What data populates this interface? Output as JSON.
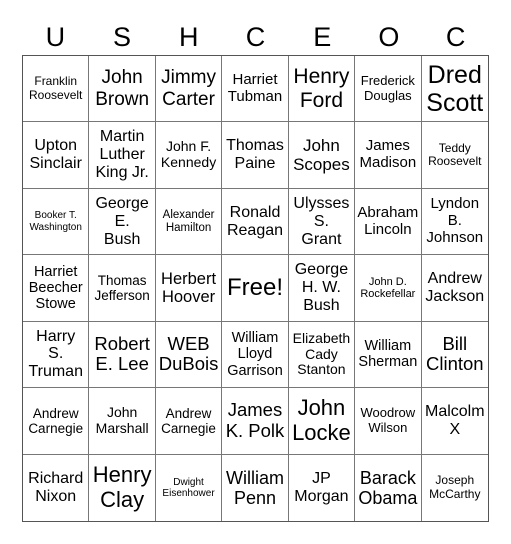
{
  "header": {
    "letters": [
      "U",
      "S",
      "H",
      "C",
      "E",
      "O",
      "C"
    ]
  },
  "cells": [
    "Franklin\nRoosevelt",
    "John\nBrown",
    "Jimmy\nCarter",
    "Harriet\nTubman",
    "Henry\nFord",
    "Frederick\nDouglas",
    "Dred\nScott",
    "Upton\nSinclair",
    "Martin\nLuther\nKing Jr.",
    "John F.\nKennedy",
    "Thomas\nPaine",
    "John\nScopes",
    "James\nMadison",
    "Teddy\nRoosevelt",
    "Booker T.\nWashington",
    "George\nE.\nBush",
    "Alexander\nHamilton",
    "Ronald\nReagan",
    "Ulysses\nS.\nGrant",
    "Abraham\nLincoln",
    "Lyndon\nB.\nJohnson",
    "Harriet\nBeecher\nStowe",
    "Thomas\nJefferson",
    "Herbert\nHoover",
    "Free!",
    "George\nH. W.\nBush",
    "John D.\nRockefellar",
    "Andrew\nJackson",
    "Harry\nS.\nTruman",
    "Robert\nE. Lee",
    "WEB\nDuBois",
    "William\nLloyd\nGarrison",
    "Elizabeth\nCady\nStanton",
    "William\nSherman",
    "Bill\nClinton",
    "Andrew\nCarnegie",
    "John\nMarshall",
    "Andrew\nCarnegie",
    "James\nK. Polk",
    "John\nLocke",
    "Woodrow\nWilson",
    "Malcolm\nX",
    "Richard\nNixon",
    "Henry\nClay",
    "Dwight\nEisenhower",
    "William\nPenn",
    "JP\nMorgan",
    "Barack\nObama",
    "Joseph\nMcCarthy"
  ],
  "free_space_index": 24
}
